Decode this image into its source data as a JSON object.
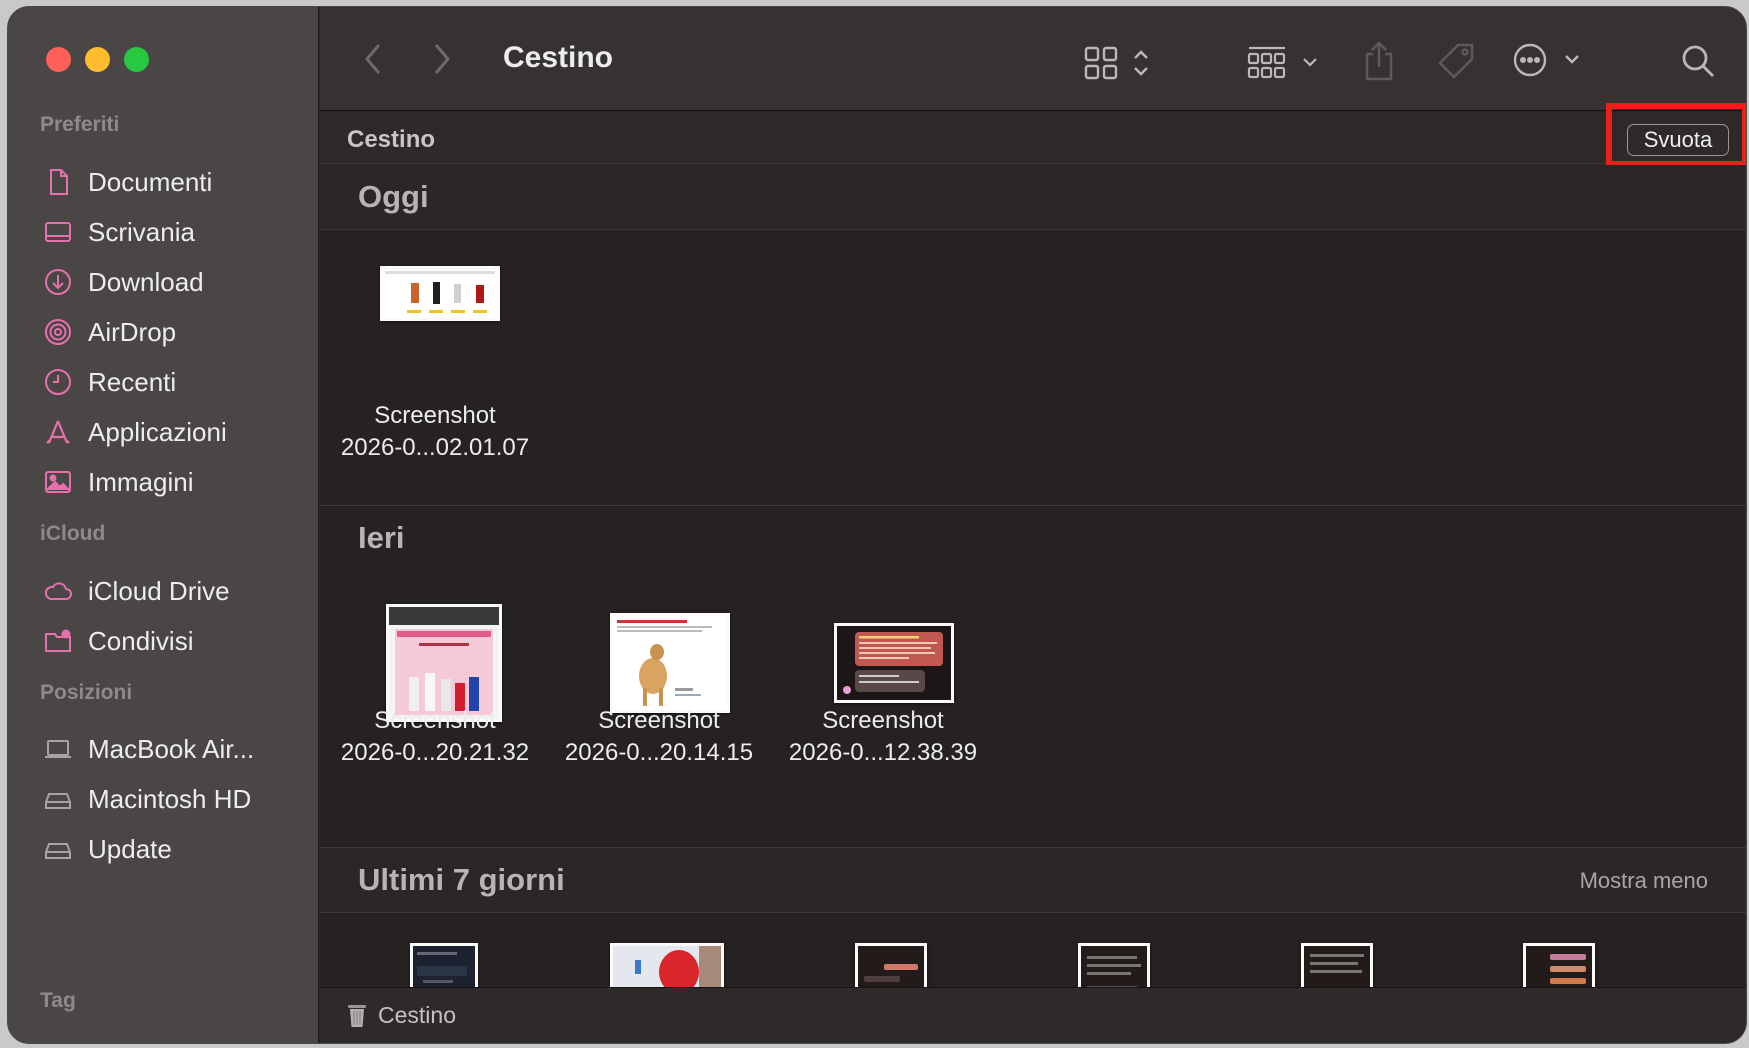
{
  "window": {
    "title": "Cestino"
  },
  "sidebar": {
    "sections": [
      {
        "label": "Preferiti",
        "items": [
          {
            "label": "Documenti",
            "icon": "document-icon"
          },
          {
            "label": "Scrivania",
            "icon": "desktop-icon"
          },
          {
            "label": "Download",
            "icon": "download-icon"
          },
          {
            "label": "AirDrop",
            "icon": "airdrop-icon"
          },
          {
            "label": "Recenti",
            "icon": "clock-icon"
          },
          {
            "label": "Applicazioni",
            "icon": "applications-icon"
          },
          {
            "label": "Immagini",
            "icon": "photo-icon"
          }
        ]
      },
      {
        "label": "iCloud",
        "items": [
          {
            "label": "iCloud Drive",
            "icon": "cloud-icon"
          },
          {
            "label": "Condivisi",
            "icon": "shared-folder-icon"
          }
        ]
      },
      {
        "label": "Posizioni",
        "items": [
          {
            "label": "MacBook Air...",
            "icon": "laptop-icon"
          },
          {
            "label": "Macintosh HD",
            "icon": "disk-icon"
          },
          {
            "label": "Update",
            "icon": "disk-icon"
          }
        ]
      },
      {
        "label": "Tag",
        "items": []
      }
    ],
    "accent_color": "#e86fae"
  },
  "toolbar": {
    "back_icon": "chevron-left-icon",
    "forward_icon": "chevron-right-icon",
    "view_icon": "grid-view-icon",
    "group_icon": "group-by-icon",
    "share_icon": "share-icon",
    "tag_icon": "tag-icon",
    "more_icon": "ellipsis-circle-icon",
    "search_icon": "search-icon"
  },
  "pathbar": {
    "label": "Cestino",
    "empty_button": "Svuota"
  },
  "groups": [
    {
      "title": "Oggi",
      "action": "",
      "files": [
        {
          "line1": "Screenshot",
          "line2": "2026-0...02.01.07"
        }
      ]
    },
    {
      "title": "Ieri",
      "action": "",
      "files": [
        {
          "line1": "Screenshot",
          "line2": "2026-0...20.21.32"
        },
        {
          "line1": "Screenshot",
          "line2": "2026-0...20.14.15"
        },
        {
          "line1": "Screenshot",
          "line2": "2026-0...12.38.39"
        }
      ]
    },
    {
      "title": "Ultimi 7 giorni",
      "action": "Mostra meno",
      "files": [
        {},
        {},
        {},
        {},
        {},
        {}
      ]
    }
  ],
  "statusbar": {
    "label": "Cestino",
    "icon": "trash-icon"
  }
}
